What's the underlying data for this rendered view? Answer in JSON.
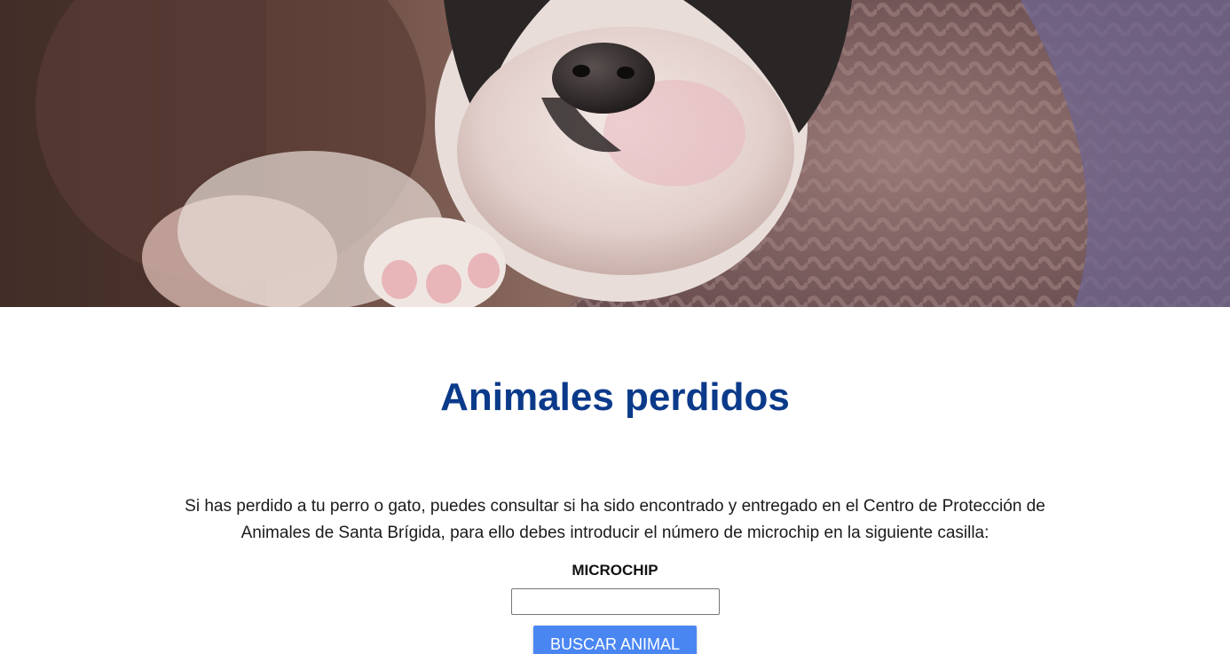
{
  "hero": {
    "image": "puppy-sleeping-in-sweater",
    "colors": {
      "sweater": "#8a6b6b",
      "sweater_purple": "#6f6590",
      "fur_white": "#efe4e0",
      "fur_black": "#2a2626",
      "background_dark": "#3a2c28"
    }
  },
  "main": {
    "title": "Animales perdidos",
    "intro_text": "Si has perdido a tu perro o gato, puedes consultar si ha sido encontrado y entregado en el Centro de Protección de Animales de Santa Brígida, para ello debes introducir el número de microchip en la siguiente casilla:",
    "form": {
      "label": "MICROCHIP",
      "input_value": "",
      "button_label": "BUSCAR ANIMAL"
    }
  },
  "colors": {
    "title": "#0b3a8a",
    "button": "#4a86f2"
  }
}
